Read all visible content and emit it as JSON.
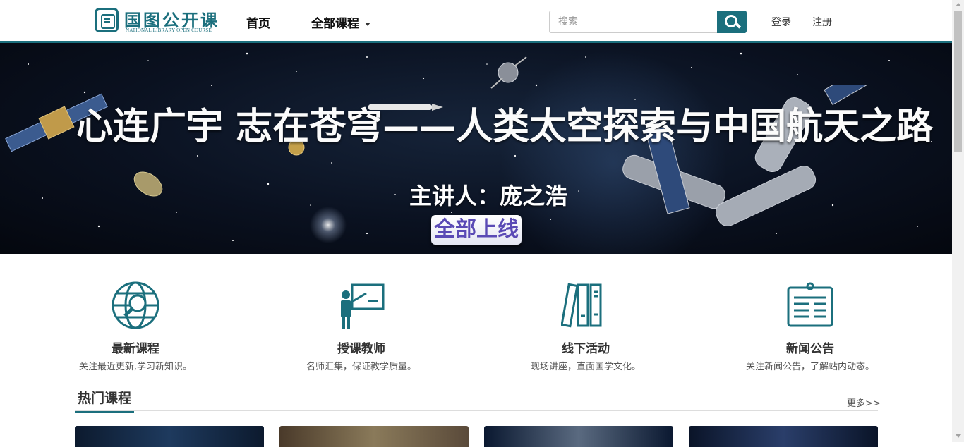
{
  "header": {
    "logo_cn": "国图公开课",
    "logo_en": "NATIONAL LIBRARY OPEN COURSE",
    "nav": {
      "home": "首页",
      "courses": "全部课程"
    },
    "search": {
      "placeholder": "搜索"
    },
    "login": "登录",
    "register": "注册"
  },
  "banner": {
    "title": "心连广宇 志在苍穹——人类太空探索与中国航天之路",
    "speaker": "主讲人：庞之浩",
    "badge": "全部上线"
  },
  "features": [
    {
      "title": "最新课程",
      "desc": "关注最近更新,学习新知识。",
      "icon": "globe-search-icon"
    },
    {
      "title": "授课教师",
      "desc": "名师汇集，保证教学质量。",
      "icon": "teacher-board-icon"
    },
    {
      "title": "线下活动",
      "desc": "现场讲座，直面国学文化。",
      "icon": "books-icon"
    },
    {
      "title": "新闻公告",
      "desc": "关注新闻公告，了解站内动态。",
      "icon": "clipboard-news-icon"
    }
  ],
  "hot": {
    "title": "热门课程",
    "more": "更多>>"
  },
  "colors": {
    "accent": "#1b6f7d"
  }
}
